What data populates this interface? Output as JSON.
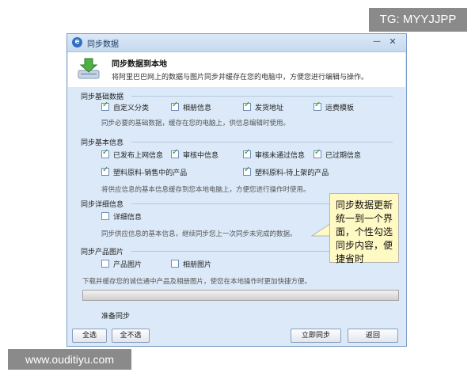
{
  "watermarks": {
    "top_right": "TG: MYYJJPP",
    "bottom_left": "www.ouditiyu.com"
  },
  "window": {
    "title": "同步数据",
    "minimize_glyph": "—",
    "close_glyph": "✕"
  },
  "header": {
    "title": "同步数据到本地",
    "description": "将阿里巴巴网上的数据与图片同步并缓存在您的电脑中，方便您进行编辑与操作。",
    "icon": "download-to-computer-icon"
  },
  "sections": {
    "basic": {
      "label": "同步基础数据",
      "options": [
        {
          "label": "自定义分类",
          "checked": true
        },
        {
          "label": "相册信息",
          "checked": true
        },
        {
          "label": "发货地址",
          "checked": true
        },
        {
          "label": "运费模板",
          "checked": true
        }
      ],
      "description": "同步必要的基础数据，缓存在您的电脑上，供信息编辑时使用。"
    },
    "info": {
      "label": "同步基本信息",
      "options": [
        {
          "label": "已发布上网信息",
          "checked": true
        },
        {
          "label": "审核中信息",
          "checked": true
        },
        {
          "label": "审核未通过信息",
          "checked": true
        },
        {
          "label": "已过期信息",
          "checked": true
        },
        {
          "label": "塑料原料-销售中的产品",
          "checked": true
        },
        {
          "label": "塑料原料-待上架的产品",
          "checked": true
        }
      ],
      "description": "将供应信息的基本信息缓存到您本地电脑上，方便您进行操作时使用。"
    },
    "detail": {
      "label": "同步详细信息",
      "options": [
        {
          "label": "详细信息",
          "checked": false
        }
      ],
      "description": "同步供应信息的基本信息，继续同步您上一次同步未完成的数据。"
    },
    "images": {
      "label": "同步产品图片",
      "options": [
        {
          "label": "产品图片",
          "checked": false
        },
        {
          "label": "相册图片",
          "checked": false
        }
      ],
      "description": "下载并缓存您的诚信通中产品及相册图片，使您在本地操作时更加快捷方便。"
    }
  },
  "progress": {
    "value": 0
  },
  "status_text": "准备同步",
  "buttons": {
    "select_all": "全选",
    "select_none": "全不选",
    "sync_now": "立即同步",
    "back": "返回"
  },
  "callout": {
    "text": "同步数据更新统一到一个界面，个性勾选同步内容，便捷省时"
  },
  "colors": {
    "checkmark": "#2d8a2d",
    "window_bg": "#dbe9f8",
    "callout_bg": "#fff9c4"
  }
}
